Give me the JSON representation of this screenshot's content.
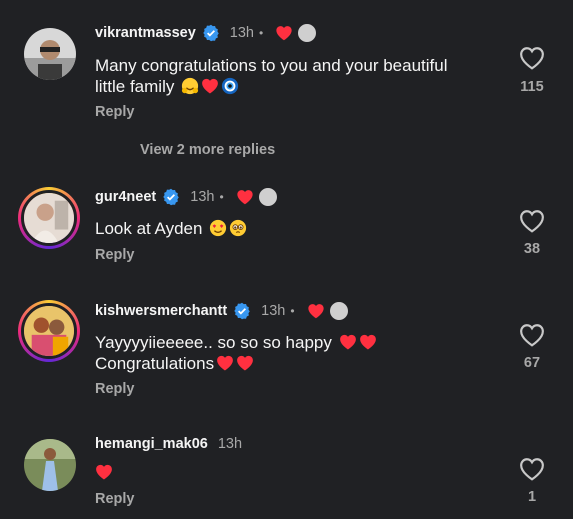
{
  "comments": [
    {
      "username": "vikrantmassey",
      "time": "13h",
      "dot": "•",
      "text": "Many congratulations to you and your beautiful little family",
      "emojis": [
        "hugging-face-emoji",
        "red-heart-emoji",
        "nazar-amulet-emoji"
      ],
      "reply": "Reply",
      "likes": "115",
      "verified": true
    },
    {
      "username": "gur4neet",
      "time": "13h",
      "dot": "•",
      "text": "Look at Ayden",
      "emojis": [
        "heart-eyes-emoji",
        "pleading-face-emoji"
      ],
      "reply": "Reply",
      "likes": "38",
      "verified": true
    },
    {
      "username": "kishwersmerchantt",
      "time": "13h",
      "dot": "•",
      "text": "Yayyyyiieeeee.. so so so happy",
      "text2": "Congratulations",
      "emojis": [
        "red-heart-emoji",
        "red-heart-emoji"
      ],
      "reply": "Reply",
      "likes": "67",
      "verified": true
    },
    {
      "username": "hemangi_mak06",
      "time": "13h",
      "text": "",
      "emojis": [
        "red-heart-emoji"
      ],
      "reply": "Reply",
      "likes": "1",
      "verified": false
    }
  ],
  "view_more": "View 2 more replies",
  "colors": {
    "background": "#202124",
    "verified": "#3897f0",
    "heart": "#ff3040",
    "muted": "#a8a8a8"
  }
}
